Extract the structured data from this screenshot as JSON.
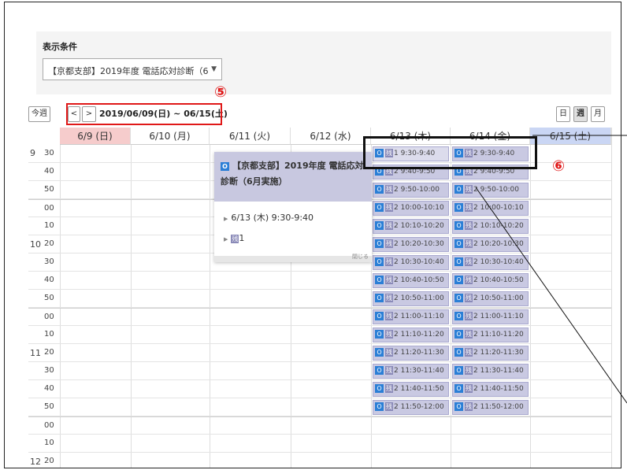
{
  "filter": {
    "title": "表示条件",
    "selected": "【京都支部】2019年度 電話応対診断（6",
    "arrow": "▼"
  },
  "toolbar": {
    "today_label": "今週",
    "prev_label": "<",
    "next_label": ">",
    "range_text": "2019/06/09(日) ~ 06/15(土)",
    "view_day": "日",
    "view_week": "週",
    "view_month": "月"
  },
  "annotations": {
    "marker_5": "⑤",
    "marker_6": "⑥"
  },
  "days": [
    {
      "label": "6/9 (日)",
      "bg": "#f6cccc"
    },
    {
      "label": "6/10 (月)",
      "bg": "#ffffff"
    },
    {
      "label": "6/11 (火)",
      "bg": "#ffffff"
    },
    {
      "label": "6/12 (水)",
      "bg": "#ffffff"
    },
    {
      "label": "6/13 (木)",
      "bg": "#ffffff"
    },
    {
      "label": "6/14 (金)",
      "bg": "#ffffff"
    },
    {
      "label": "6/15 (土)",
      "bg": "#cad6f4"
    }
  ],
  "time_rows": [
    {
      "hour": "9",
      "minute": "30"
    },
    {
      "hour": "",
      "minute": "40"
    },
    {
      "hour": "",
      "minute": "50"
    },
    {
      "hour": "10",
      "minute": "00"
    },
    {
      "hour": "",
      "minute": "10"
    },
    {
      "hour": "",
      "minute": "20"
    },
    {
      "hour": "",
      "minute": "30"
    },
    {
      "hour": "",
      "minute": "40"
    },
    {
      "hour": "",
      "minute": "50"
    },
    {
      "hour": "11",
      "minute": "00"
    },
    {
      "hour": "",
      "minute": "10"
    },
    {
      "hour": "",
      "minute": "20"
    },
    {
      "hour": "",
      "minute": "30"
    },
    {
      "hour": "",
      "minute": "40"
    },
    {
      "hour": "",
      "minute": "50"
    },
    {
      "hour": "12",
      "minute": "00"
    },
    {
      "hour": "",
      "minute": "10"
    },
    {
      "hour": "",
      "minute": "20"
    },
    {
      "hour": "",
      "minute": "30"
    }
  ],
  "slot_icon": "O",
  "remain_label": "残",
  "slots_thu": [
    {
      "remain": "1",
      "time": "9:30-9:40"
    },
    {
      "remain": "2",
      "time": "9:40-9:50"
    },
    {
      "remain": "2",
      "time": "9:50-10:00"
    },
    {
      "remain": "2",
      "time": "10:00-10:10"
    },
    {
      "remain": "2",
      "time": "10:10-10:20"
    },
    {
      "remain": "2",
      "time": "10:20-10:30"
    },
    {
      "remain": "2",
      "time": "10:30-10:40"
    },
    {
      "remain": "2",
      "time": "10:40-10:50"
    },
    {
      "remain": "2",
      "time": "10:50-11:00"
    },
    {
      "remain": "2",
      "time": "11:00-11:10"
    },
    {
      "remain": "2",
      "time": "11:10-11:20"
    },
    {
      "remain": "2",
      "time": "11:20-11:30"
    },
    {
      "remain": "2",
      "time": "11:30-11:40"
    },
    {
      "remain": "2",
      "time": "11:40-11:50"
    },
    {
      "remain": "2",
      "time": "11:50-12:00"
    }
  ],
  "slots_fri": [
    {
      "remain": "2",
      "time": "9:30-9:40"
    },
    {
      "remain": "2",
      "time": "9:40-9:50"
    },
    {
      "remain": "2",
      "time": "9:50-10:00"
    },
    {
      "remain": "2",
      "time": "10:00-10:10"
    },
    {
      "remain": "2",
      "time": "10:10-10:20"
    },
    {
      "remain": "2",
      "time": "10:20-10:30"
    },
    {
      "remain": "2",
      "time": "10:30-10:40"
    },
    {
      "remain": "2",
      "time": "10:40-10:50"
    },
    {
      "remain": "2",
      "time": "10:50-11:00"
    },
    {
      "remain": "2",
      "time": "11:00-11:10"
    },
    {
      "remain": "2",
      "time": "11:10-11:20"
    },
    {
      "remain": "2",
      "time": "11:20-11:30"
    },
    {
      "remain": "2",
      "time": "11:30-11:40"
    },
    {
      "remain": "2",
      "time": "11:40-11:50"
    },
    {
      "remain": "2",
      "time": "11:50-12:00"
    }
  ],
  "popup": {
    "title": "【京都支部】2019年度 電話応対診断（6月実施）",
    "datetime": "6/13 (木) 9:30-9:40",
    "remain_count": "1",
    "close": "閉じる"
  }
}
